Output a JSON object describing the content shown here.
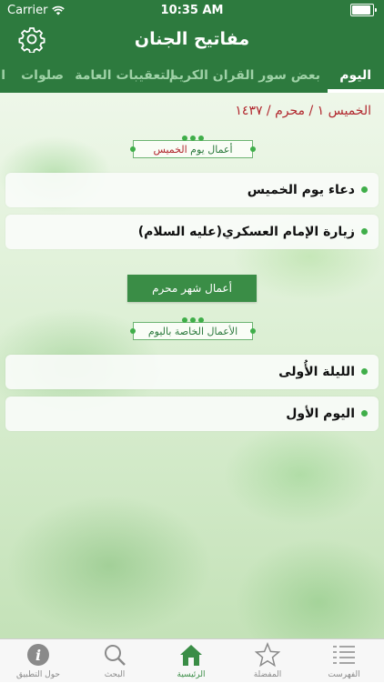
{
  "status_bar": {
    "carrier": "Carrier",
    "time": "10:35 AM",
    "battery_level": 0.9
  },
  "nav": {
    "title": "مفاتيح الجنان",
    "settings_icon": "gear-icon"
  },
  "tabs": [
    {
      "label": "اليوم",
      "active": true
    },
    {
      "label": "بعض سور القران الكريم",
      "active": false
    },
    {
      "label": "التعقيبات العامة",
      "active": false
    },
    {
      "label": "صلوات",
      "active": false
    },
    {
      "label": "ا",
      "active": false
    }
  ],
  "date_text": "الخميس ١ / محرم / ١٤٣٧",
  "day_section": {
    "prefix": "أعمال يوم",
    "highlight": "الخميس"
  },
  "day_items": [
    {
      "text": "دعاء يوم الخميس"
    },
    {
      "text": "زيارة الإمام العسكري(عليه السلام)"
    }
  ],
  "month_button": "أعمال شهر محرم",
  "special_section": {
    "label": "الأعمال الخاصة باليوم"
  },
  "special_items": [
    {
      "text": "الليلة الأُولى"
    },
    {
      "text": "اليوم الأول"
    }
  ],
  "tab_bar": [
    {
      "label": "حول التطبيق",
      "icon": "info-icon",
      "active": false
    },
    {
      "label": "البحث",
      "icon": "search-icon",
      "active": false
    },
    {
      "label": "الرئيسية",
      "icon": "home-icon",
      "active": true
    },
    {
      "label": "المفضلة",
      "icon": "star-icon",
      "active": false
    },
    {
      "label": "الفهرست",
      "icon": "list-icon",
      "active": false
    }
  ],
  "colors": {
    "primary": "#2d7a3e",
    "accent": "#3fae49",
    "date_red": "#b1272e"
  }
}
